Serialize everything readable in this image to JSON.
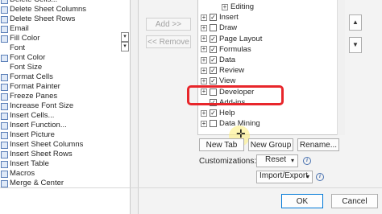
{
  "commands": [
    {
      "label": "Delete Cells...",
      "icon": "delete-cells-icon"
    },
    {
      "label": "Delete Sheet Columns",
      "icon": "delete-columns-icon"
    },
    {
      "label": "Delete Sheet Rows",
      "icon": "delete-rows-icon"
    },
    {
      "label": "Email",
      "icon": "email-icon"
    },
    {
      "label": "Fill Color",
      "icon": "fill-color-icon"
    },
    {
      "label": "Font",
      "icon": ""
    },
    {
      "label": "Font Color",
      "icon": "font-color-icon"
    },
    {
      "label": "Font Size",
      "icon": ""
    },
    {
      "label": "Format Cells",
      "icon": "format-cells-icon"
    },
    {
      "label": "Format Painter",
      "icon": "format-painter-icon"
    },
    {
      "label": "Freeze Panes",
      "icon": "freeze-panes-icon"
    },
    {
      "label": "Increase Font Size",
      "icon": "increase-font-icon"
    },
    {
      "label": "Insert Cells...",
      "icon": "insert-cells-icon"
    },
    {
      "label": "Insert Function...",
      "icon": "insert-function-icon"
    },
    {
      "label": "Insert Picture",
      "icon": "insert-picture-icon"
    },
    {
      "label": "Insert Sheet Columns",
      "icon": "insert-columns-icon"
    },
    {
      "label": "Insert Sheet Rows",
      "icon": "insert-rows-icon"
    },
    {
      "label": "Insert Table",
      "icon": "insert-table-icon"
    },
    {
      "label": "Macros",
      "icon": "macros-icon"
    },
    {
      "label": "Merge & Center",
      "icon": "merge-center-icon"
    }
  ],
  "add_button": "Add >>",
  "remove_button": "<< Remove",
  "tabs": [
    {
      "label": "Editing",
      "expand": false,
      "checked": null,
      "indent": true
    },
    {
      "label": "Insert",
      "expand": true,
      "checked": true,
      "indent": false
    },
    {
      "label": "Draw",
      "expand": true,
      "checked": false,
      "indent": false
    },
    {
      "label": "Page Layout",
      "expand": true,
      "checked": true,
      "indent": false
    },
    {
      "label": "Formulas",
      "expand": true,
      "checked": true,
      "indent": false
    },
    {
      "label": "Data",
      "expand": true,
      "checked": true,
      "indent": false
    },
    {
      "label": "Review",
      "expand": true,
      "checked": true,
      "indent": false
    },
    {
      "label": "View",
      "expand": true,
      "checked": true,
      "indent": false
    },
    {
      "label": "Developer",
      "expand": true,
      "checked": false,
      "indent": false
    },
    {
      "label": "Add-ins",
      "expand": false,
      "checked": true,
      "indent": false
    },
    {
      "label": "Help",
      "expand": true,
      "checked": true,
      "indent": false
    },
    {
      "label": "Data Mining",
      "expand": true,
      "checked": false,
      "indent": false
    }
  ],
  "new_tab_button": "New Tab",
  "new_group_button": "New Group",
  "rename_button": "Rename...",
  "customizations_label": "Customizations:",
  "reset_button": "Reset",
  "import_export_button": "Import/Export",
  "ok_button": "OK",
  "cancel_button": "Cancel",
  "colors": {
    "highlight": "#e8262b",
    "accent": "#0078d7"
  }
}
